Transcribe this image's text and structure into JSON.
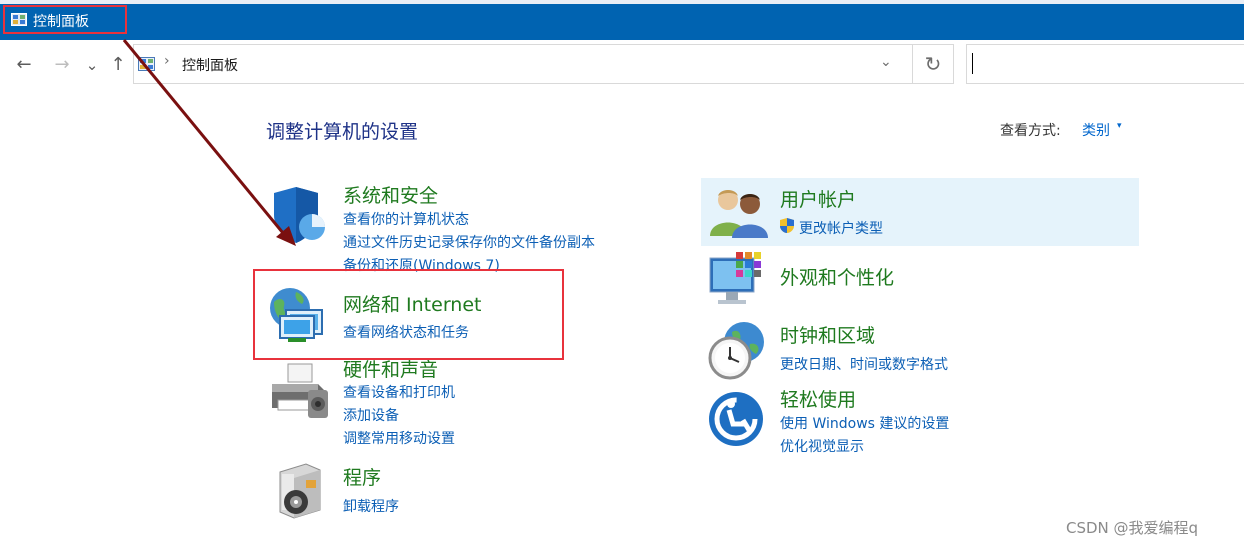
{
  "window": {
    "title": "控制面板"
  },
  "address_bar": {
    "breadcrumb": "控制面板",
    "separator": "›"
  },
  "nav": {
    "back": "←",
    "forward": "→",
    "recent": "⌄",
    "up": "↑",
    "dropdown": "⌄",
    "refresh": "↻"
  },
  "page": {
    "heading": "调整计算机的设置",
    "view_by_label": "查看方式:",
    "view_by_value": "类别",
    "view_by_arrow": "▾"
  },
  "categories_left": [
    {
      "title": "系统和安全",
      "icon": "shield-icon",
      "links": [
        "查看你的计算机状态",
        "通过文件历史记录保存你的文件备份副本",
        "备份和还原(Windows 7)"
      ]
    },
    {
      "title": "网络和 Internet",
      "icon": "network-globe-icon",
      "links": [
        "查看网络状态和任务"
      ]
    },
    {
      "title": "硬件和声音",
      "icon": "printer-icon",
      "links": [
        "查看设备和打印机",
        "添加设备",
        "调整常用移动设置"
      ]
    },
    {
      "title": "程序",
      "icon": "programs-disc-icon",
      "links": [
        "卸载程序"
      ]
    }
  ],
  "categories_right": [
    {
      "title": "用户帐户",
      "icon": "users-icon",
      "links": [
        "更改帐户类型"
      ]
    },
    {
      "title": "外观和个性化",
      "icon": "monitor-palette-icon",
      "links": []
    },
    {
      "title": "时钟和区域",
      "icon": "clock-globe-icon",
      "links": [
        "更改日期、时间或数字格式"
      ]
    },
    {
      "title": "轻松使用",
      "icon": "ease-of-access-icon",
      "links": [
        "使用 Windows 建议的设置",
        "优化视觉显示"
      ]
    }
  ],
  "watermark": "CSDN @我爱编程q",
  "colors": {
    "titlebar": "#0063b1",
    "category_title": "#1f7a1f",
    "link": "#0c5fb5",
    "heading": "#1e3287",
    "highlight": "#e5f3fb",
    "annotation": "#e8323c",
    "arrow": "#7a1010"
  }
}
